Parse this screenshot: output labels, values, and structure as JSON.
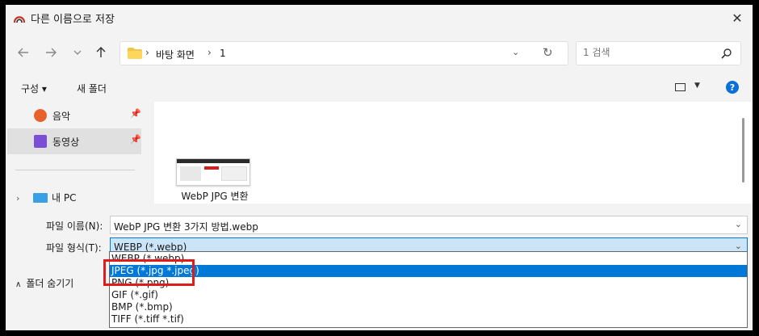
{
  "window": {
    "title": "다른 이름으로 저장",
    "close_label": "✕"
  },
  "nav": {
    "back_icon": "arrow-left-icon",
    "forward_icon": "arrow-right-icon",
    "recent_icon": "chevron-down-icon",
    "up_icon": "arrow-up-icon",
    "breadcrumbs": [
      "바탕 화면",
      "1"
    ],
    "search_placeholder": "1 검색"
  },
  "toolbar": {
    "organize_label": "구성 ▾",
    "new_folder_label": "새 폴더",
    "help_label": "?"
  },
  "sidebar": {
    "items": [
      {
        "label": "음악",
        "icon": "music-icon",
        "color": "#e8612c"
      },
      {
        "label": "동영상",
        "icon": "video-icon",
        "color": "#7a4fd6"
      }
    ],
    "pc_label": "내 PC"
  },
  "files": [
    {
      "name": "WebP JPG 변환"
    }
  ],
  "form": {
    "filename_label": "파일 이름(N):",
    "filename_value": "WebP JPG 변환 3가지 방법.webp",
    "filetype_label": "파일 형식(T):",
    "filetype_value": "WEBP (*.webp)",
    "hide_folders_label": "폴더 숨기기"
  },
  "dropdown": {
    "options": [
      "WEBP (*.webp)",
      "JPEG (*.jpg *.jpeg)",
      "PNG (*.png)",
      "GIF (*.gif)",
      "BMP (*.bmp)",
      "TIFF (*.tiff *.tif)"
    ],
    "selected_index": 1
  },
  "colors": {
    "accent": "#0078d7",
    "highlight_box": "#e01b1b"
  }
}
